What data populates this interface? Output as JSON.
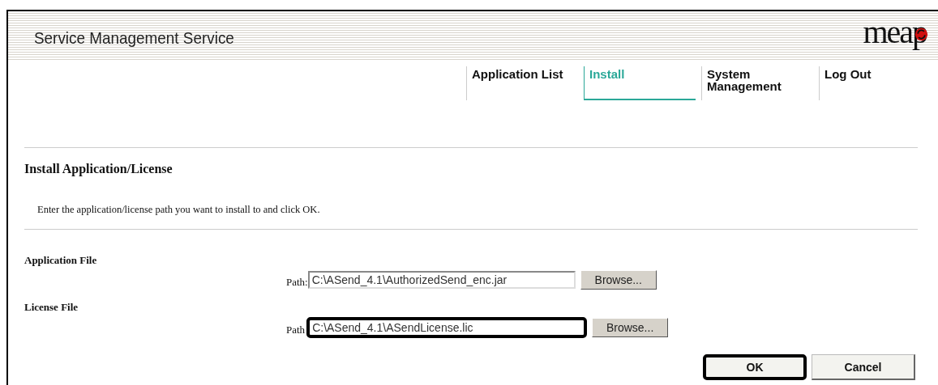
{
  "header": {
    "title": "Service Management Service",
    "logo": "meap"
  },
  "tabs": [
    {
      "label": "Application List",
      "selected": false
    },
    {
      "label": "Install",
      "selected": true
    },
    {
      "label": "System Management",
      "selected": false
    },
    {
      "label": "Log Out",
      "selected": false
    }
  ],
  "heading": "Install Application/License",
  "instruction": "Enter the application/license path you want to install to and click OK.",
  "files": [
    {
      "label": "Application File",
      "path_label": "Path:",
      "value": "C:\\ASend_4.1\\AuthorizedSend_enc.jar",
      "browse": "Browse...",
      "highlighted": false
    },
    {
      "label": "License File",
      "path_label": "Path",
      "value": "C:\\ASend_4.1\\ASendLicense.lic",
      "browse": "Browse...",
      "highlighted": true
    }
  ],
  "buttons": [
    {
      "label": "OK",
      "highlighted": true
    },
    {
      "label": "Cancel",
      "highlighted": false
    }
  ]
}
